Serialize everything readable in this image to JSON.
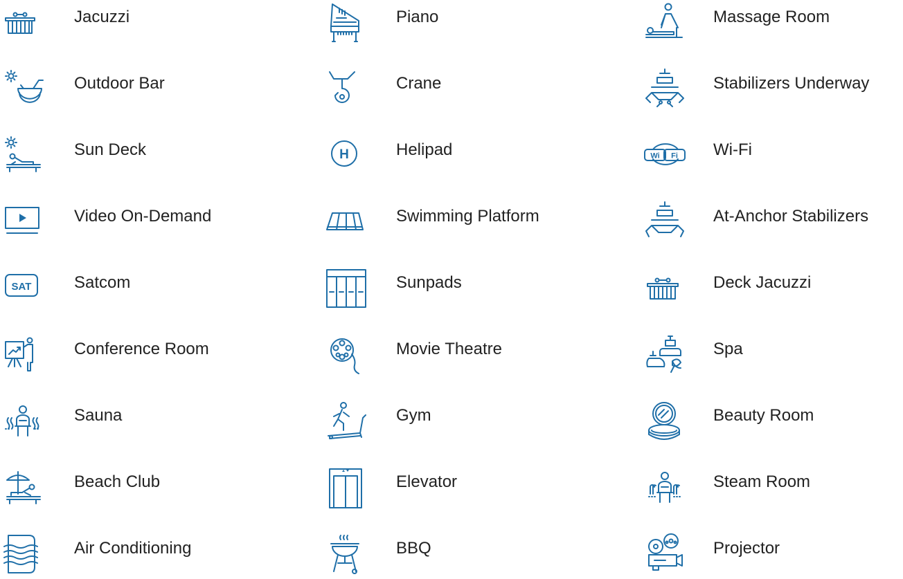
{
  "accent_color": "#1f6fa8",
  "columns": [
    {
      "items": [
        {
          "label": "Jacuzzi",
          "icon": "jacuzzi-icon"
        },
        {
          "label": "Outdoor Bar",
          "icon": "outdoor-bar-icon"
        },
        {
          "label": "Sun Deck",
          "icon": "sun-deck-icon"
        },
        {
          "label": "Video On-Demand",
          "icon": "video-on-demand-icon"
        },
        {
          "label": "Satcom",
          "icon": "satcom-icon"
        },
        {
          "label": "Conference Room",
          "icon": "conference-room-icon"
        },
        {
          "label": "Sauna",
          "icon": "sauna-icon"
        },
        {
          "label": "Beach Club",
          "icon": "beach-club-icon"
        },
        {
          "label": "Air Conditioning",
          "icon": "air-conditioning-icon"
        }
      ]
    },
    {
      "items": [
        {
          "label": "Piano",
          "icon": "piano-icon"
        },
        {
          "label": "Crane",
          "icon": "crane-icon"
        },
        {
          "label": "Helipad",
          "icon": "helipad-icon"
        },
        {
          "label": "Swimming Platform",
          "icon": "swimming-platform-icon"
        },
        {
          "label": "Sunpads",
          "icon": "sunpads-icon"
        },
        {
          "label": "Movie Theatre",
          "icon": "movie-theatre-icon"
        },
        {
          "label": "Gym",
          "icon": "gym-icon"
        },
        {
          "label": "Elevator",
          "icon": "elevator-icon"
        },
        {
          "label": "BBQ",
          "icon": "bbq-icon"
        }
      ]
    },
    {
      "items": [
        {
          "label": "Massage Room",
          "icon": "massage-room-icon"
        },
        {
          "label": "Stabilizers Underway",
          "icon": "stabilizers-underway-icon"
        },
        {
          "label": "Wi-Fi",
          "icon": "wifi-icon"
        },
        {
          "label": "At-Anchor Stabilizers",
          "icon": "at-anchor-stabilizers-icon"
        },
        {
          "label": "Deck Jacuzzi",
          "icon": "deck-jacuzzi-icon"
        },
        {
          "label": "Spa",
          "icon": "spa-icon"
        },
        {
          "label": "Beauty Room",
          "icon": "beauty-room-icon"
        },
        {
          "label": "Steam Room",
          "icon": "steam-room-icon"
        },
        {
          "label": "Projector",
          "icon": "projector-icon"
        }
      ]
    }
  ],
  "icon_text": {
    "helipad": "H",
    "wifi_left": "Wi",
    "wifi_right": "Fi",
    "satcom": "SAT"
  }
}
